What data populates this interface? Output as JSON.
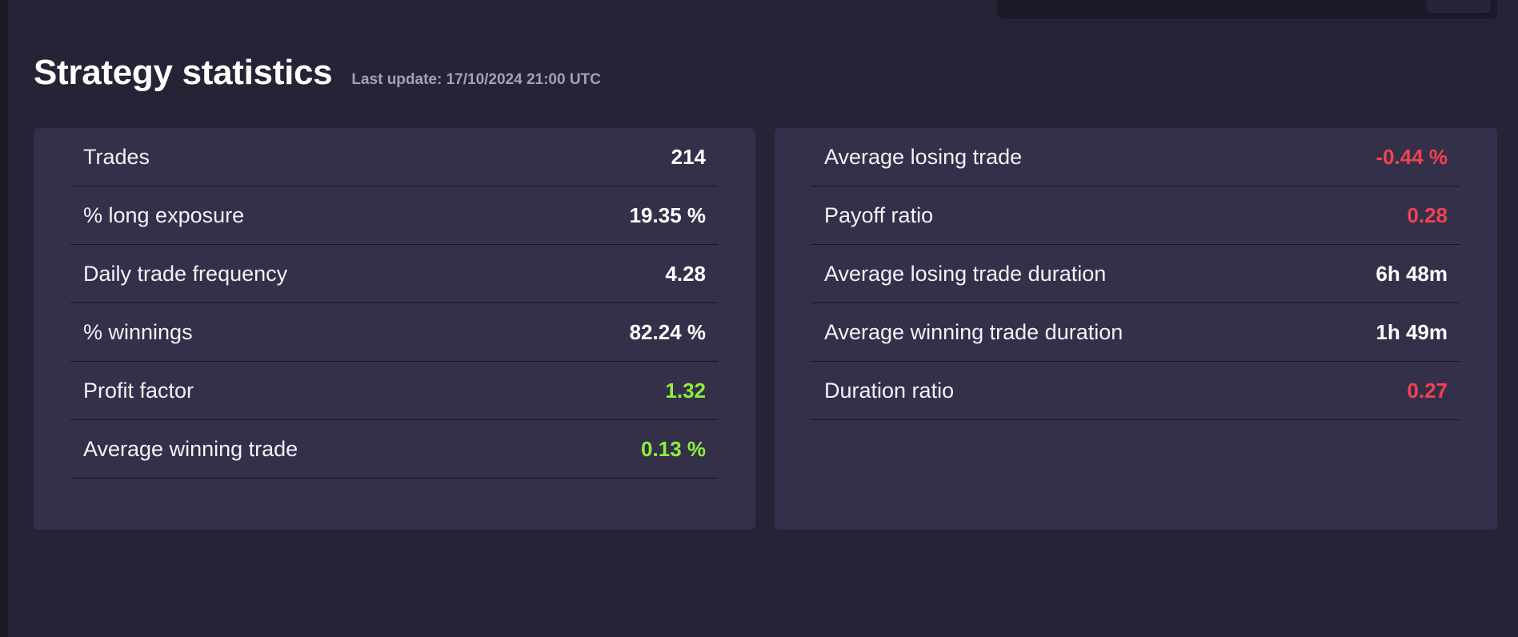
{
  "header": {
    "title": "Strategy statistics",
    "last_update": "Last update: 17/10/2024 21:00 UTC"
  },
  "left_stats": [
    {
      "label": "Trades",
      "value": "214",
      "tone": "neutral"
    },
    {
      "label": "% long exposure",
      "value": "19.35 %",
      "tone": "neutral"
    },
    {
      "label": "Daily trade frequency",
      "value": "4.28",
      "tone": "neutral"
    },
    {
      "label": "% winnings",
      "value": "82.24 %",
      "tone": "neutral"
    },
    {
      "label": "Profit factor",
      "value": "1.32",
      "tone": "positive"
    },
    {
      "label": "Average winning trade",
      "value": "0.13 %",
      "tone": "positive"
    }
  ],
  "right_stats": [
    {
      "label": "Average losing trade",
      "value": "-0.44 %",
      "tone": "negative"
    },
    {
      "label": "Payoff ratio",
      "value": "0.28",
      "tone": "negative"
    },
    {
      "label": "Average losing trade duration",
      "value": "6h 48m",
      "tone": "neutral"
    },
    {
      "label": "Average winning trade duration",
      "value": "1h 49m",
      "tone": "neutral"
    },
    {
      "label": "Duration ratio",
      "value": "0.27",
      "tone": "negative"
    }
  ],
  "colors": {
    "background": "#252336",
    "card": "#34304a",
    "positive": "#8ef03a",
    "negative": "#f0434f",
    "muted_text": "#a3a0b8"
  }
}
